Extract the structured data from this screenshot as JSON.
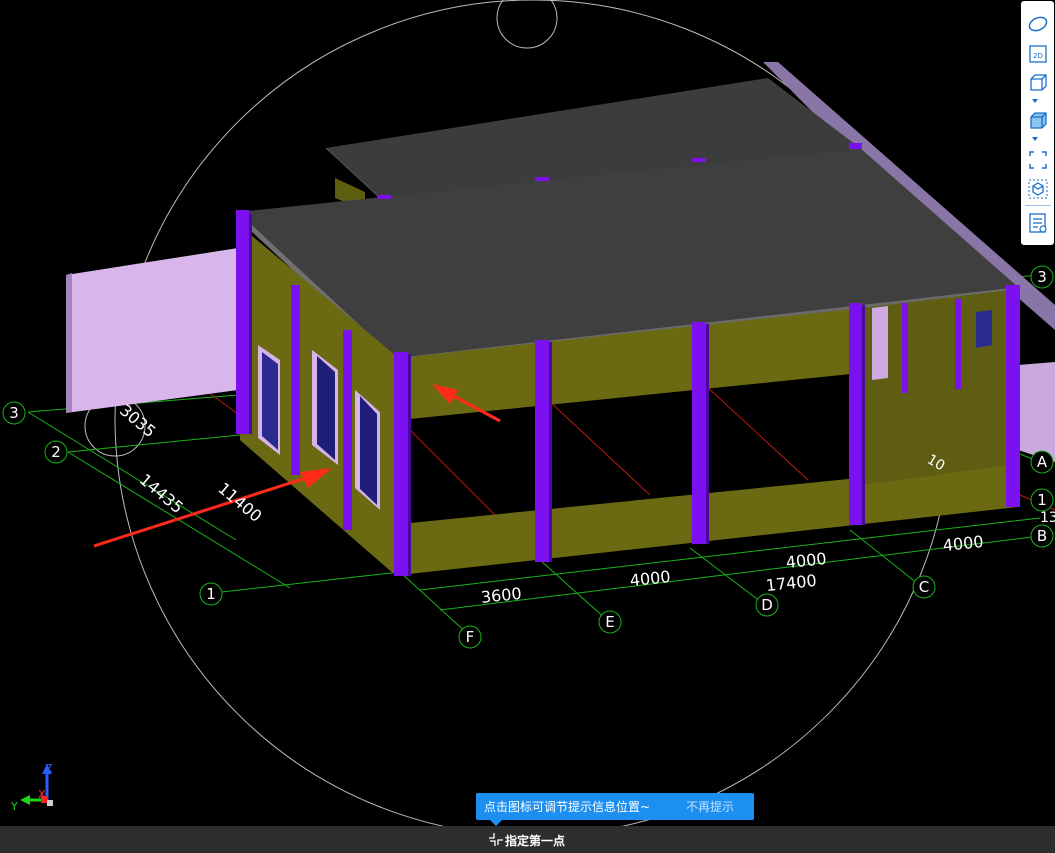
{
  "viewport": {
    "axis_labels": {
      "rows": [
        "3",
        "2",
        "1",
        "3",
        "1"
      ],
      "cols": [
        "A",
        "B",
        "C",
        "D",
        "E",
        "F"
      ]
    },
    "dimensions": {
      "left": [
        "3035",
        "14435",
        "11400"
      ],
      "front": [
        "3600",
        "4000",
        "4000",
        "4000",
        "17400"
      ],
      "partial_right": "13",
      "partial_wall": "10"
    },
    "triad": {
      "x": "X",
      "y": "Y",
      "z": "Z"
    }
  },
  "view_toolbar": {
    "items": [
      {
        "icon": "orbit-icon"
      },
      {
        "icon": "2d-view-icon",
        "label": "2D"
      },
      {
        "icon": "3d-box-icon"
      },
      {
        "icon": "3d-solid-box-icon"
      },
      {
        "icon": "fit-view-icon"
      },
      {
        "icon": "local-3d-icon"
      },
      {
        "icon": "display-settings-icon"
      }
    ]
  },
  "tip": {
    "message": "点击图标可调节提示信息位置~",
    "dismiss": "不再提示"
  },
  "status": {
    "prompt": "指定第一点"
  },
  "colors": {
    "background": "#000000",
    "wall": "#6b6a13",
    "column": "#7b10f0",
    "slab": "#3a3a3a",
    "grid": "#19b319",
    "tip_bg": "#1d8ff0",
    "annotation": "#ff2a1a"
  }
}
